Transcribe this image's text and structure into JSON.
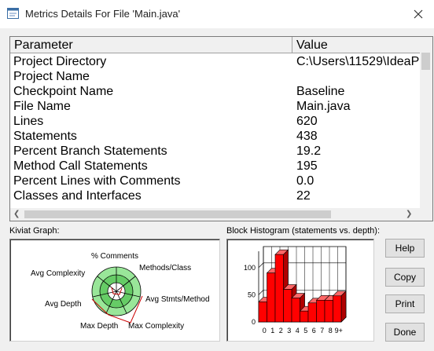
{
  "window": {
    "title": "Metrics Details For File 'Main.java'"
  },
  "table": {
    "headers": {
      "parameter": "Parameter",
      "value": "Value"
    },
    "rows": [
      {
        "parameter": "Project Directory",
        "value": "C:\\Users\\11529\\IdeaP"
      },
      {
        "parameter": "Project Name",
        "value": ""
      },
      {
        "parameter": "Checkpoint Name",
        "value": "Baseline"
      },
      {
        "parameter": "File Name",
        "value": "Main.java"
      },
      {
        "parameter": "Lines",
        "value": "620"
      },
      {
        "parameter": "Statements",
        "value": "438"
      },
      {
        "parameter": "Percent Branch Statements",
        "value": "19.2"
      },
      {
        "parameter": "Method Call Statements",
        "value": "195"
      },
      {
        "parameter": "Percent Lines with Comments",
        "value": "0.0"
      },
      {
        "parameter": "Classes and Interfaces",
        "value": "22"
      }
    ]
  },
  "kiviat": {
    "label": "Kiviat Graph:",
    "axes": [
      "% Comments",
      "Methods/Class",
      "Avg Stmts/Method",
      "Max Complexity",
      "Max Depth",
      "Avg Depth",
      "Avg Complexity"
    ]
  },
  "histogram": {
    "label": "Block Histogram (statements vs. depth):",
    "y_ticks": [
      "100",
      "50",
      "0"
    ],
    "x_ticks": [
      "0",
      "1",
      "2",
      "3",
      "4",
      "5",
      "6",
      "7",
      "8",
      "9+"
    ],
    "values": [
      37,
      90,
      124,
      60,
      44,
      20,
      35,
      40,
      40,
      48
    ],
    "bar_color": "#ff0000"
  },
  "buttons": {
    "help": "Help",
    "copy": "Copy",
    "print": "Print",
    "done": "Done"
  }
}
